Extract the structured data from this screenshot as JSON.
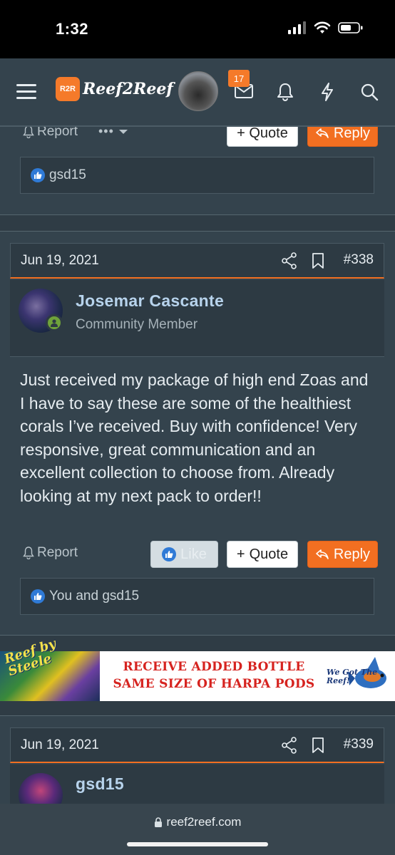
{
  "status_bar": {
    "time": "1:32"
  },
  "nav": {
    "site_name": "Reef2Reef",
    "logo_abbr": "R2R",
    "conversations_badge": "17"
  },
  "prev_post": {
    "report_label": "Report",
    "quote_label": "+ Quote",
    "reply_label": "Reply",
    "reactions_text": "gsd15"
  },
  "post_338": {
    "date": "Jun 19, 2021",
    "number": "#338",
    "author": "Josemar Cascante",
    "author_title": "Community Member",
    "body": "Just received my package of high end Zoas and I have to say these are some of the healthiest corals I’ve received. Buy with confidence! Very responsive, great communication and an excellent collection to choose from. Already looking at my next pack to order!!",
    "report_label": "Report",
    "like_label": "Like",
    "quote_label": "Quote",
    "reply_label": "Reply",
    "reactions_text": "You and gsd15"
  },
  "ad": {
    "left_text": "Reef by Steele",
    "line1": "RECEIVE ADDED BOTTLE",
    "line2": "SAME SIZE OF HARPA PODS",
    "right_text": "We Got The Reef!"
  },
  "post_339": {
    "date": "Jun 19, 2021",
    "number": "#339",
    "author": "gsd15"
  },
  "browser": {
    "url": "reef2reef.com"
  },
  "colors": {
    "accent": "#f26f21",
    "like_blue": "#2f7ad6",
    "background": "#2f3c45"
  }
}
